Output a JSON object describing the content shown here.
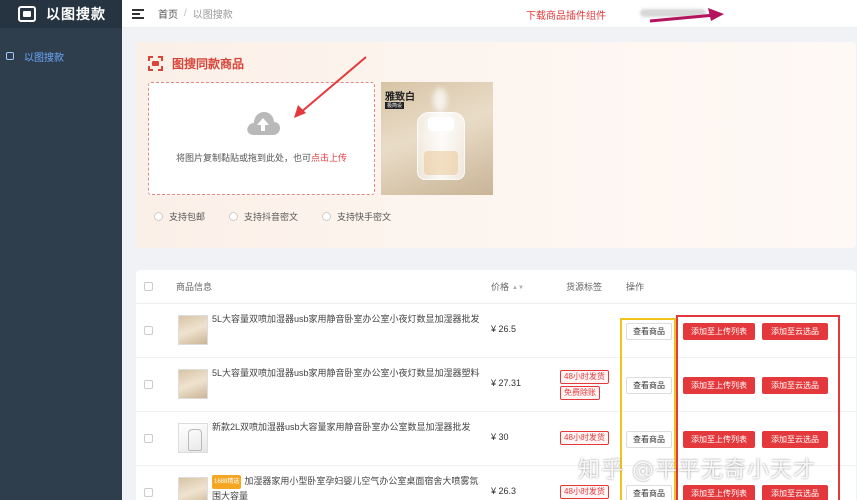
{
  "app": {
    "title": "以图搜款"
  },
  "sidebar": {
    "items": [
      {
        "label": "以图搜款"
      }
    ]
  },
  "header": {
    "breadcrumb_home": "首页",
    "breadcrumb_sep": "/",
    "breadcrumb_current": "以图搜款",
    "plugin_link": "下载商品插件组件"
  },
  "upload": {
    "title": "图搜同款商品",
    "drop_text": "将图片复制黏贴或拖到此处，也可",
    "drop_link": "点击上传",
    "preview_title": "雅致白",
    "preview_sub": "极简设",
    "options": [
      "支持包邮",
      "支持抖音密文",
      "支持快手密文"
    ]
  },
  "table": {
    "headers": {
      "info": "商品信息",
      "price": "价格",
      "tags": "货源标签",
      "actions": "操作"
    },
    "rows": [
      {
        "name": "5L大容量双喷加湿器usb家用静音卧室办公室小夜灯数显加湿器批发",
        "price": "¥ 26.5",
        "badges": [],
        "tag": "",
        "thumb": "beige"
      },
      {
        "name": "5L大容量双喷加湿器usb家用静音卧室办公室小夜灯数显加湿器塑料",
        "price": "¥ 27.31",
        "badges": [
          "48小时发货",
          "免费除账"
        ],
        "tag": "",
        "thumb": "beige"
      },
      {
        "name": "新款2L双喷加湿器usb大容量家用静音卧室办公室数显加湿器批发",
        "price": "¥ 30",
        "badges": [
          "48小时发货"
        ],
        "tag": "",
        "thumb": "white"
      },
      {
        "name": "加湿器家用小型卧室孕妇婴儿空气办公室桌面宿舍大喷雾氛围大容量",
        "price": "¥ 26.3",
        "badges": [
          "48小时发货"
        ],
        "tag": "1688精选",
        "thumb": "beige"
      }
    ],
    "btn_view": "查看商品",
    "btn_upload": "添加至上传列表",
    "btn_cloud": "添加至云选品"
  },
  "watermark": "知乎 @平平无奇小天才",
  "colors": {
    "accent": "#e4393c",
    "sidebar": "#2f3e4c",
    "highlight_yellow": "#f0c419"
  }
}
